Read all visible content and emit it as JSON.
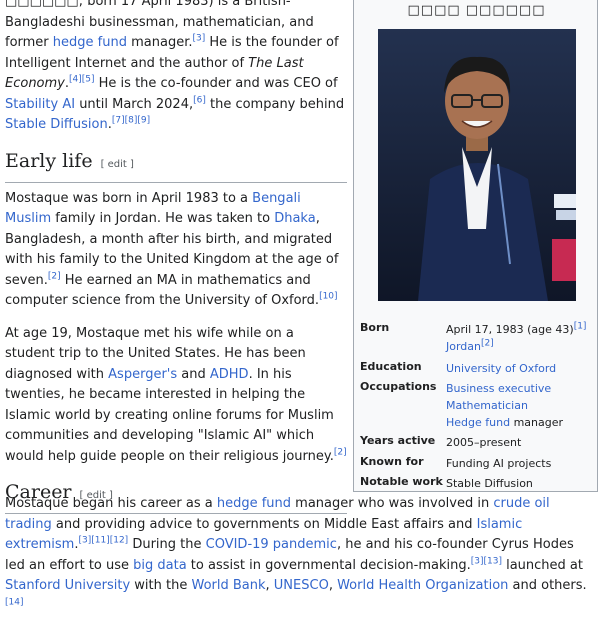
{
  "intro": {
    "native_name_fragment": "□□□□□□",
    "born_text": "; born 17 April 1983) is a British-Bangladeshi businessman, mathematician, and former ",
    "hedge_fund": "hedge fund",
    "manager_text": " manager.",
    "ref3": "[3]",
    "founder_text": " He is the founder of Intelligent Internet and the author of ",
    "book": "The Last Economy",
    "ref45": "[4][5]",
    "cofounder_text": " He is the co-founder and was CEO of ",
    "stability_ai": "Stability AI",
    "until_text": " until March 2024,",
    "ref6": "[6]",
    "company_text": " the company behind ",
    "stable_diffusion": "Stable Diffusion",
    "ref789": "[7][8][9]"
  },
  "early_life": {
    "heading": "Early life",
    "edit": "[ edit ]",
    "p1_a": "Mostaque was born in April 1983 to a ",
    "bengali_muslim": "Bengali Muslim",
    "p1_b": " family in Jordan. He was taken to ",
    "dhaka": "Dhaka",
    "p1_c": ", Bangladesh, a month after his birth, and migrated with his family to the United Kingdom at the age of seven.",
    "ref2": "[2]",
    "p1_d": " He earned an MA in mathematics and computer science from the University of Oxford.",
    "ref10": "[10]",
    "p2_a": "At age 19, Mostaque met his wife while on a student trip to the United States. He has been diagnosed with ",
    "aspergers": "Asperger's",
    "p2_b": " and ",
    "adhd": "ADHD",
    "p2_c": ". In his twenties, he became interested in helping the Islamic world by creating online forums for Muslim communities and developing \"Islamic AI\" which would help guide people on their religious journey.",
    "ref2b": "[2]"
  },
  "career": {
    "heading": "Career",
    "edit": "[ edit ]",
    "p_a": "Mostaque began his career as a ",
    "hedge_fund": "hedge fund",
    "p_b": " manager who was involved in ",
    "crude_oil": "crude oil trading",
    "p_c": " and providing advice to governments on Middle East affairs and ",
    "islamic_extremism": "Islamic extremism",
    "p_d": ".",
    "ref31112": "[3][11][12]",
    "p_e": " During the ",
    "covid": "COVID-19 pandemic",
    "p_f": ", he and his co-founder Cyrus Hodes led an effort to use ",
    "big_data": "big data",
    "p_g": " to assist in governmental decision-making.",
    "ref313": "[3][13]",
    "p_h": " launched at ",
    "stanford": "Stanford University",
    "p_i": " with the ",
    "world_bank": "World Bank",
    "comma1": ", ",
    "unesco": "UNESCO",
    "comma2": ", ",
    "who": "World Health Organization",
    "p_j": " and others.",
    "ref14": "[14]"
  },
  "infobox": {
    "native_name": "□□□□ □□□□□□",
    "photo_icon": "portrait-photo",
    "born_label": "Born",
    "born_date": "April 17, 1983 (age 43)",
    "born_ref": "[1]",
    "born_place": "Jordan",
    "born_place_ref": "[2]",
    "education_label": "Education",
    "education": "University of Oxford",
    "occupations_label": "Occupations",
    "occ1": "Business executive",
    "occ2": "Mathematician",
    "occ3_link": "Hedge fund",
    "occ3_rest": " manager",
    "years_label": "Years active",
    "years": "2005–present",
    "known_label": "Known for",
    "known": "Funding AI projects",
    "notable_label": "Notable work",
    "notable": "Stable Diffusion"
  }
}
